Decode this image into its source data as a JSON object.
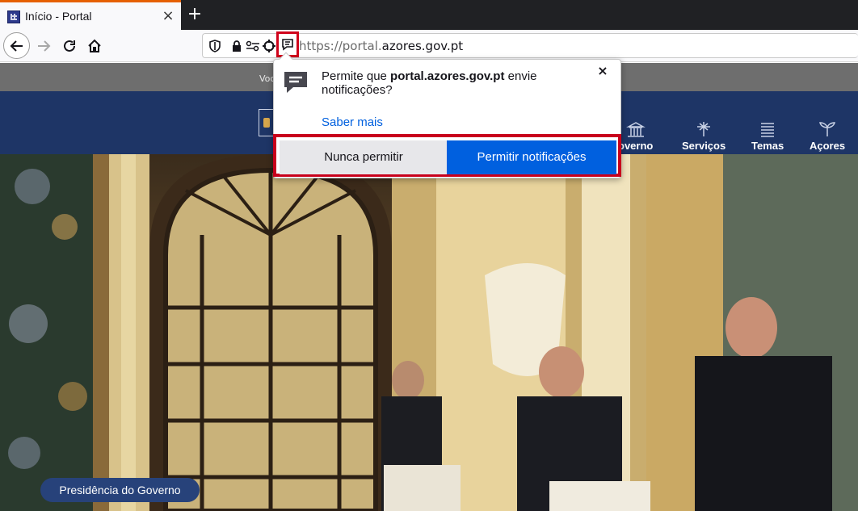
{
  "browser": {
    "tab": {
      "title": "Início - Portal",
      "close_glyph": "×",
      "favicon": "azores-portal-favicon"
    },
    "new_tab_glyph": "+",
    "url": {
      "scheme": "https://",
      "host_prefix": "portal.",
      "host_domain": "azores.gov.pt"
    }
  },
  "page": {
    "topstrip_text": "Voc",
    "menu": [
      {
        "label": "overno",
        "icon": "building-icon"
      },
      {
        "label": "Serviços",
        "icon": "services-icon"
      },
      {
        "label": "Temas",
        "icon": "list-icon"
      },
      {
        "label": "Açores",
        "icon": "plant-icon"
      }
    ],
    "hero_badge": "Presidência do Governo",
    "colors": {
      "header": "#1e3566",
      "badge": "#27427a",
      "accent_red": "#c8001c",
      "allow_blue": "#0060df"
    }
  },
  "popup": {
    "message_before": "Permite que ",
    "message_host": "portal.azores.gov.pt",
    "message_after": " envie notificações?",
    "close_glyph": "×",
    "learn_more": "Saber mais",
    "never_allow": "Nunca permitir",
    "allow": "Permitir notificações"
  }
}
